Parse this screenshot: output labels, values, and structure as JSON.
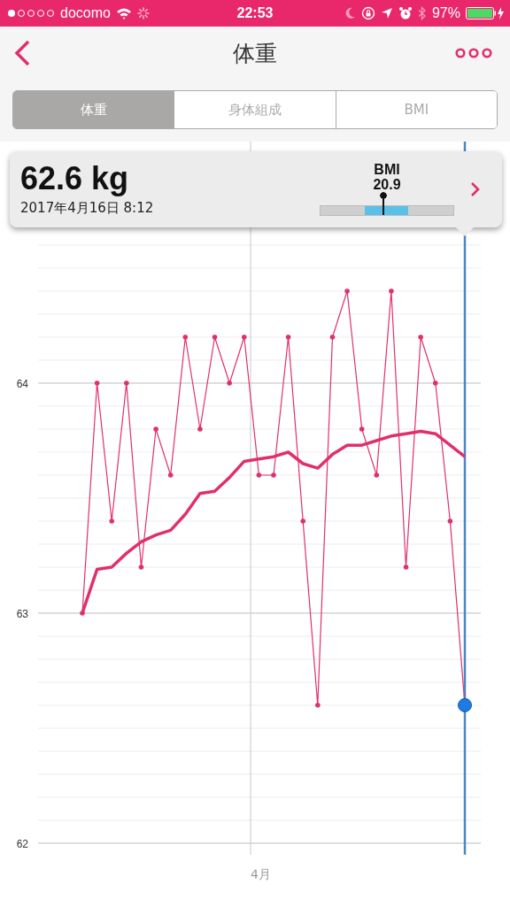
{
  "status_bar": {
    "carrier": "docomo",
    "time": "22:53",
    "battery": "97%"
  },
  "nav": {
    "title": "体重"
  },
  "tabs": [
    {
      "label": "体重",
      "selected": true
    },
    {
      "label": "身体組成",
      "selected": false
    },
    {
      "label": "BMI",
      "selected": false
    }
  ],
  "reading": {
    "weight": "62.6 kg",
    "datetime": "2017年4月16日 8:12",
    "bmi_label": "BMI",
    "bmi_value": "20.9",
    "level": 0.47
  },
  "month_label": "4月",
  "chart_data": {
    "type": "line",
    "grid": true,
    "series": [
      {
        "color": "#e0306a",
        "values": [
          63.0,
          64.0,
          63.4,
          64.0,
          63.2,
          63.8,
          63.6,
          64.2,
          63.8,
          64.2,
          64.0,
          64.2,
          63.6,
          63.6,
          64.2,
          63.4,
          62.6,
          64.2,
          64.4,
          63.8,
          63.6,
          64.4,
          63.2,
          64.2,
          64.0,
          63.4,
          62.6
        ]
      },
      {
        "color": "#e0306a",
        "values": [
          63.0,
          63.19,
          63.2,
          63.26,
          63.31,
          63.34,
          63.36,
          63.43,
          63.52,
          63.53,
          63.59,
          63.66,
          63.67,
          63.68,
          63.7,
          63.65,
          63.63,
          63.69,
          63.73,
          63.73,
          63.75,
          63.77,
          63.78,
          63.79,
          63.78,
          63.73,
          63.68
        ]
      }
    ],
    "ylim": [
      62,
      65.05
    ],
    "yticks": [
      {
        "value": 62,
        "label": "62"
      },
      {
        "value": 63,
        "label": "63"
      },
      {
        "value": 64,
        "label": "64"
      }
    ]
  }
}
